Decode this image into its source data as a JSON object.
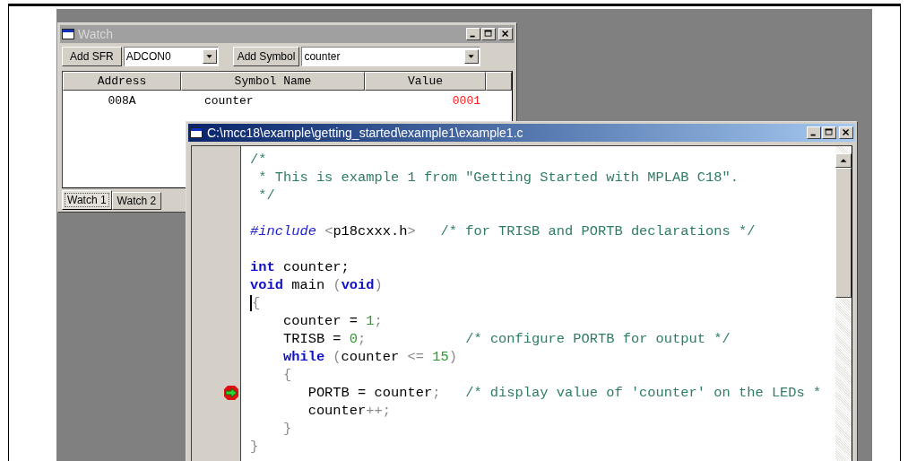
{
  "watch": {
    "title": "Watch",
    "add_sfr": "Add SFR",
    "sfr_select": "ADCON0",
    "add_symbol": "Add Symbol",
    "symbol_select": "counter",
    "columns": [
      "Address",
      "Symbol Name",
      "Value"
    ],
    "rows": [
      {
        "address": "008A",
        "symbol": "counter",
        "value": "0001"
      }
    ],
    "tabs": [
      {
        "label": "Watch 1",
        "selected": true
      },
      {
        "label": "Watch 2",
        "selected": false
      }
    ]
  },
  "editor": {
    "title": "C:\\mcc18\\example\\getting_started\\example1\\example1.c",
    "lines": [
      {
        "cursor": false,
        "marker": false,
        "segments": [
          {
            "kind": "comment",
            "text": "/*"
          }
        ]
      },
      {
        "cursor": false,
        "marker": false,
        "segments": [
          {
            "kind": "comment",
            "text": " * This is example 1 from \"Getting Started with MPLAB C18\"."
          }
        ]
      },
      {
        "cursor": false,
        "marker": false,
        "segments": [
          {
            "kind": "comment",
            "text": " */"
          }
        ]
      },
      {
        "cursor": false,
        "marker": false
      },
      {
        "cursor": false,
        "marker": false,
        "segments": [
          {
            "kind": "directive",
            "text": "#include"
          },
          {
            "kind": "punct",
            "text": " <"
          },
          {
            "kind": "plain",
            "text": "p18cxxx.h"
          },
          {
            "kind": "punct",
            "text": ">"
          },
          {
            "kind": "comment",
            "text": "   /* for TRISB and PORTB declarations */"
          }
        ]
      },
      {
        "cursor": false,
        "marker": false
      },
      {
        "cursor": false,
        "marker": false,
        "segments": [
          {
            "kind": "keyword",
            "text": "int"
          },
          {
            "kind": "plain",
            "text": " counter;"
          }
        ]
      },
      {
        "cursor": false,
        "marker": false,
        "segments": [
          {
            "kind": "keyword",
            "text": "void"
          },
          {
            "kind": "plain",
            "text": " main "
          },
          {
            "kind": "punct",
            "text": "("
          },
          {
            "kind": "keyword",
            "text": "void"
          },
          {
            "kind": "punct",
            "text": ")"
          }
        ]
      },
      {
        "cursor": true,
        "marker": false,
        "segments": [
          {
            "kind": "punct",
            "text": "{"
          }
        ]
      },
      {
        "cursor": false,
        "marker": false,
        "segments": [
          {
            "kind": "plain",
            "text": "    counter = "
          },
          {
            "kind": "number",
            "text": "1"
          },
          {
            "kind": "punct",
            "text": ";"
          }
        ]
      },
      {
        "cursor": false,
        "marker": false,
        "segments": [
          {
            "kind": "plain",
            "text": "    TRISB = "
          },
          {
            "kind": "number",
            "text": "0"
          },
          {
            "kind": "punct",
            "text": ";"
          },
          {
            "kind": "comment",
            "text": "            /* configure PORTB for output */"
          }
        ]
      },
      {
        "cursor": false,
        "marker": false,
        "segments": [
          {
            "kind": "keyword",
            "text": "    while"
          },
          {
            "kind": "punct",
            "text": " ("
          },
          {
            "kind": "plain",
            "text": "counter "
          },
          {
            "kind": "punct",
            "text": "<= "
          },
          {
            "kind": "number",
            "text": "15"
          },
          {
            "kind": "punct",
            "text": ")"
          }
        ]
      },
      {
        "cursor": false,
        "marker": false,
        "segments": [
          {
            "kind": "punct",
            "text": "    {"
          }
        ]
      },
      {
        "cursor": false,
        "marker": true,
        "segments": [
          {
            "kind": "plain",
            "text": "       PORTB = counter"
          },
          {
            "kind": "punct",
            "text": ";"
          },
          {
            "kind": "comment",
            "text": "   /* display value of 'counter' on the LEDs *"
          }
        ]
      },
      {
        "cursor": false,
        "marker": false,
        "segments": [
          {
            "kind": "plain",
            "text": "       counter"
          },
          {
            "kind": "punct",
            "text": "++;"
          }
        ]
      },
      {
        "cursor": false,
        "marker": false,
        "segments": [
          {
            "kind": "punct",
            "text": "    }"
          }
        ]
      },
      {
        "cursor": false,
        "marker": false,
        "segments": [
          {
            "kind": "punct",
            "text": "}"
          }
        ]
      }
    ]
  }
}
